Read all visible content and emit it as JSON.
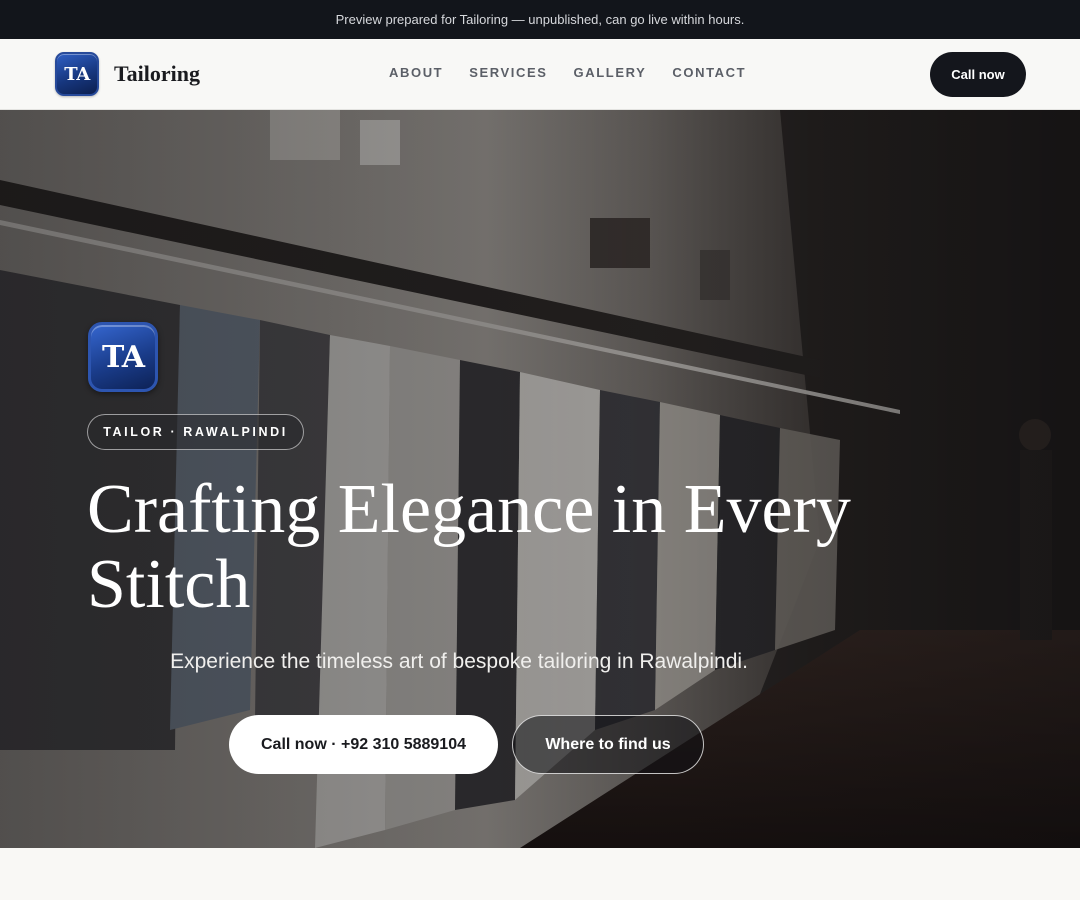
{
  "preview_bar": {
    "text": "Preview prepared for Tailoring — unpublished, can go live within hours."
  },
  "header": {
    "logo_initials": "TA",
    "brand_name": "Tailoring",
    "nav": [
      {
        "label": "ABOUT"
      },
      {
        "label": "SERVICES"
      },
      {
        "label": "GALLERY"
      },
      {
        "label": "CONTACT"
      }
    ],
    "cta_label": "Call now"
  },
  "hero": {
    "logo_initials": "TA",
    "chip": "TAILOR · RAWALPINDI",
    "title": "Crafting Elegance in Every Stitch",
    "subtitle": "Experience the timeless art of bespoke tailoring in Rawalpindi.",
    "primary_button": "Call now · +92 310 5889104",
    "secondary_button": "Where to find us",
    "background_image": "clothing-boutique-rack-photo"
  },
  "colors": {
    "dark": "#14161c",
    "brand_blue": "#1a3c8a",
    "page_bg": "#f8f7f4"
  }
}
